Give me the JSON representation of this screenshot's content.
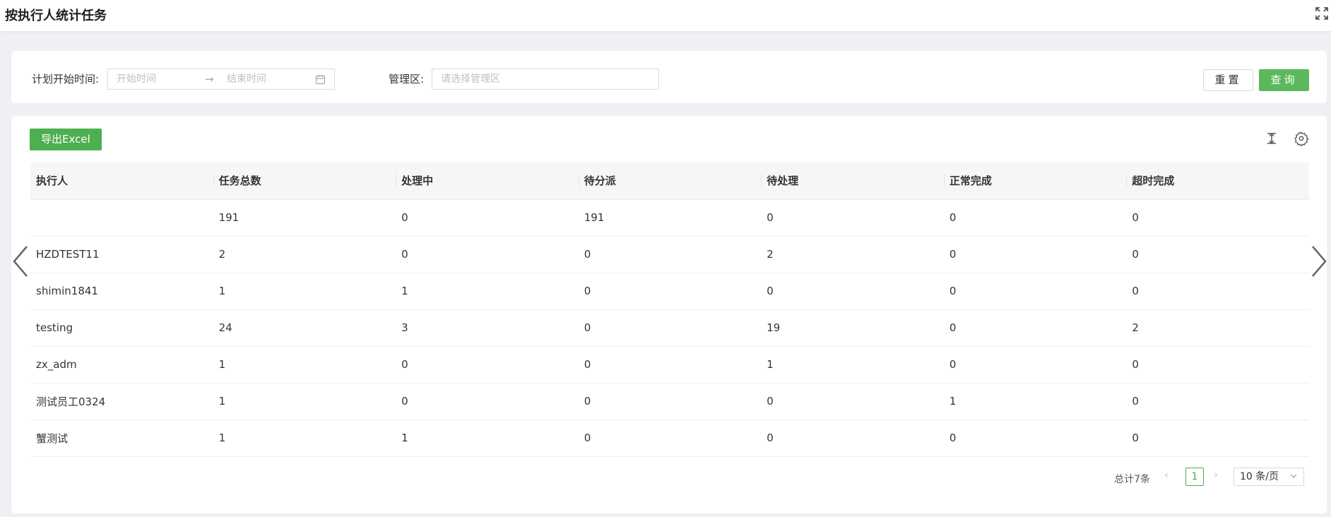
{
  "header": {
    "title": "按执行人统计任务"
  },
  "filters": {
    "date_label": "计划开始时间:",
    "start_placeholder": "开始时间",
    "end_placeholder": "结束时间",
    "area_label": "管理区:",
    "area_placeholder": "请选择管理区",
    "reset_label": "重置",
    "query_label": "查询"
  },
  "toolbar": {
    "export_label": "导出Excel"
  },
  "table": {
    "columns": [
      "执行人",
      "任务总数",
      "处理中",
      "待分派",
      "待处理",
      "正常完成",
      "超时完成"
    ],
    "rows": [
      [
        "",
        "191",
        "0",
        "191",
        "0",
        "0",
        "0"
      ],
      [
        "HZDTEST11",
        "2",
        "0",
        "0",
        "2",
        "0",
        "0"
      ],
      [
        "shimin1841",
        "1",
        "1",
        "0",
        "0",
        "0",
        "0"
      ],
      [
        "testing",
        "24",
        "3",
        "0",
        "19",
        "0",
        "2"
      ],
      [
        "zx_adm",
        "1",
        "0",
        "0",
        "1",
        "0",
        "0"
      ],
      [
        "测试员工0324",
        "1",
        "0",
        "0",
        "0",
        "1",
        "0"
      ],
      [
        "蟹测试",
        "1",
        "1",
        "0",
        "0",
        "0",
        "0"
      ]
    ]
  },
  "pagination": {
    "total": "总计7条",
    "page": "1",
    "page_size": "10 条/页"
  },
  "colors": {
    "primary": "#5cb85c",
    "export": "#4caf50"
  }
}
